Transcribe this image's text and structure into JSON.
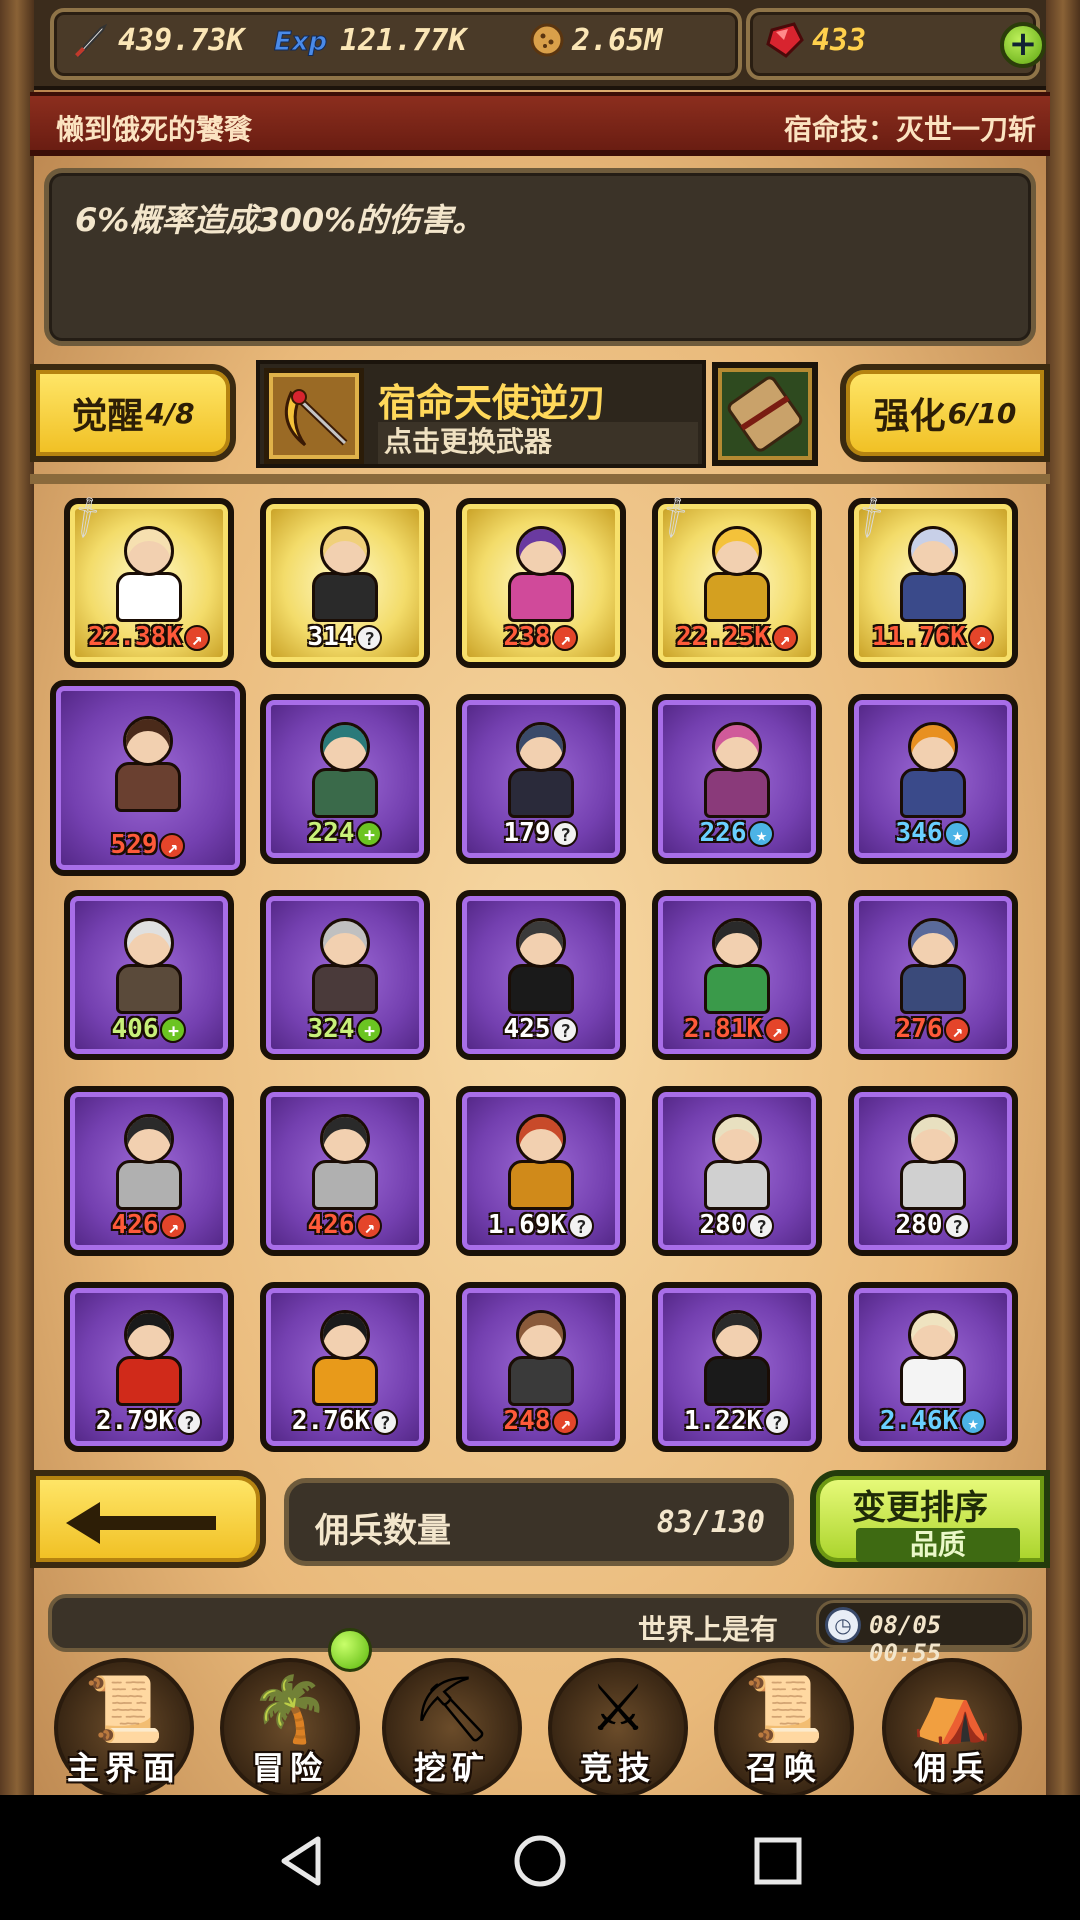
{
  "resources": {
    "attack": "439.73K",
    "exp": "121.77K",
    "gold": "2.65M",
    "gems": "433",
    "exp_icon_text": "Exp",
    "plus_label": "+"
  },
  "skill": {
    "name": "懒到饿死的饕餮",
    "destiny": "宿命技：灭世一刀斩",
    "description": "6%概率造成300%的伤害。"
  },
  "awaken": {
    "label": "觉醒",
    "value": "4/8"
  },
  "enhance": {
    "label": "强化",
    "value": "6/10"
  },
  "weapon": {
    "title": "宿命天使逆刃",
    "subtitle": "点击更换武器"
  },
  "heroes": [
    {
      "label": "22.38K",
      "badge": "fire",
      "tier": "gold",
      "sword": true
    },
    {
      "label": "314",
      "badge": "q",
      "tier": "gold",
      "sword": false
    },
    {
      "label": "238",
      "badge": "fire",
      "tier": "gold",
      "sword": false
    },
    {
      "label": "22.25K",
      "badge": "fire",
      "tier": "gold",
      "sword": true
    },
    {
      "label": "11.76K",
      "badge": "fire",
      "tier": "gold",
      "sword": true
    },
    {
      "label": "529",
      "badge": "fire",
      "tier": "purple",
      "sword": false
    },
    {
      "label": "224",
      "badge": "plus",
      "tier": "purple",
      "sword": false
    },
    {
      "label": "179",
      "badge": "q",
      "tier": "purple",
      "sword": false
    },
    {
      "label": "226",
      "badge": "star",
      "tier": "purple",
      "sword": false
    },
    {
      "label": "346",
      "badge": "star",
      "tier": "purple",
      "sword": false
    },
    {
      "label": "406",
      "badge": "plus",
      "tier": "purple",
      "sword": false
    },
    {
      "label": "324",
      "badge": "plus",
      "tier": "purple",
      "sword": false
    },
    {
      "label": "425",
      "badge": "q",
      "tier": "purple",
      "sword": false
    },
    {
      "label": "2.81K",
      "badge": "fire",
      "tier": "purple",
      "sword": false
    },
    {
      "label": "276",
      "badge": "fire",
      "tier": "purple",
      "sword": false
    },
    {
      "label": "426",
      "badge": "fire",
      "tier": "purple",
      "sword": false
    },
    {
      "label": "426",
      "badge": "fire",
      "tier": "purple",
      "sword": false
    },
    {
      "label": "1.69K",
      "badge": "q",
      "tier": "purple",
      "sword": false
    },
    {
      "label": "280",
      "badge": "q",
      "tier": "purple",
      "sword": false
    },
    {
      "label": "280",
      "badge": "q",
      "tier": "purple",
      "sword": false
    },
    {
      "label": "2.79K",
      "badge": "q",
      "tier": "purple",
      "sword": false
    },
    {
      "label": "2.76K",
      "badge": "q",
      "tier": "purple",
      "sword": false
    },
    {
      "label": "248",
      "badge": "fire",
      "tier": "purple",
      "sword": false
    },
    {
      "label": "1.22K",
      "badge": "q",
      "tier": "purple",
      "sword": false
    },
    {
      "label": "2.46K",
      "badge": "star",
      "tier": "purple",
      "sword": false
    }
  ],
  "mercenary_count": {
    "label": "佣兵数量",
    "value": "83/130"
  },
  "sort": {
    "title": "变更排序",
    "mode": "品质"
  },
  "ticker": {
    "text": "世界上是有",
    "time": "08/05 00:55"
  },
  "nav": [
    {
      "label": "主界面",
      "icon": "map-scroll-icon",
      "glyph": "📜"
    },
    {
      "label": "冒险",
      "icon": "island-icon",
      "glyph": "🌴"
    },
    {
      "label": "挖矿",
      "icon": "pickaxe-icon",
      "glyph": "⛏"
    },
    {
      "label": "竞技",
      "icon": "crossed-swords-icon",
      "glyph": "⚔"
    },
    {
      "label": "召唤",
      "icon": "summon-scroll-icon",
      "glyph": "📜"
    },
    {
      "label": "佣兵",
      "icon": "tent-icon",
      "glyph": "⛺"
    }
  ],
  "colors": {
    "gold_button": "#f0bf22",
    "purple_card": "#7440b0",
    "skill_bar": "#8c2e1e",
    "sort_button": "#a9d32a",
    "badge_fire": "#e4452a",
    "badge_plus": "#6bc422",
    "badge_star": "#4cb3e6"
  }
}
